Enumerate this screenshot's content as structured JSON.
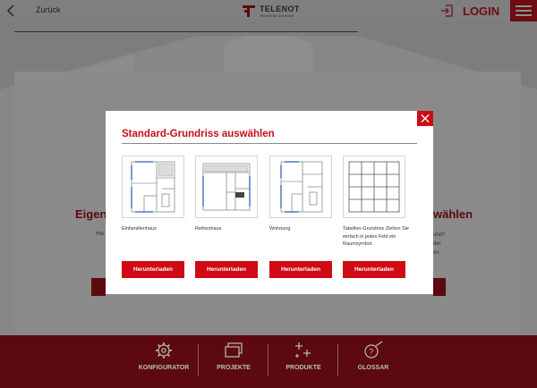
{
  "topbar": {
    "back_label": "Zurück",
    "logo_word": "TELENOT",
    "logo_tagline": "Technik für Sicherheit",
    "login_label": "LOGIN"
  },
  "background": {
    "heading_left": "Eigene",
    "heading_right": "wählen",
    "text_left": "Hie",
    "text_right_lines": [
      "und?",
      "der",
      "en"
    ]
  },
  "modal": {
    "title": "Standard-Grundriss auswählen",
    "options": [
      {
        "label": "Einfamilienhaus",
        "button": "Herunterladen",
        "icon": "floorplan-house-icon"
      },
      {
        "label": "Reihenhaus",
        "button": "Herunterladen",
        "icon": "floorplan-row-house-icon"
      },
      {
        "label": "Wohnung",
        "button": "Herunterladen",
        "icon": "floorplan-apartment-icon"
      },
      {
        "label": "Tabellen-Grundriss Ziehen Sie einfach in jedes Feld ein Raumsymbol.",
        "button": "Herunterladen",
        "icon": "grid-table-icon"
      }
    ]
  },
  "bottom_nav": {
    "items": [
      {
        "label": "KONFIGURATOR",
        "icon": "gear-icon"
      },
      {
        "label": "PROJEKTE",
        "icon": "stacked-windows-icon"
      },
      {
        "label": "PRODUKTE",
        "icon": "plus-sparkle-icon"
      },
      {
        "label": "GLOSSAR",
        "icon": "question-pen-icon"
      }
    ]
  },
  "colors": {
    "accent_red": "#cf0a14",
    "dimmed_red": "#6d0c12",
    "overlay_gray": "#7f7f7f"
  }
}
